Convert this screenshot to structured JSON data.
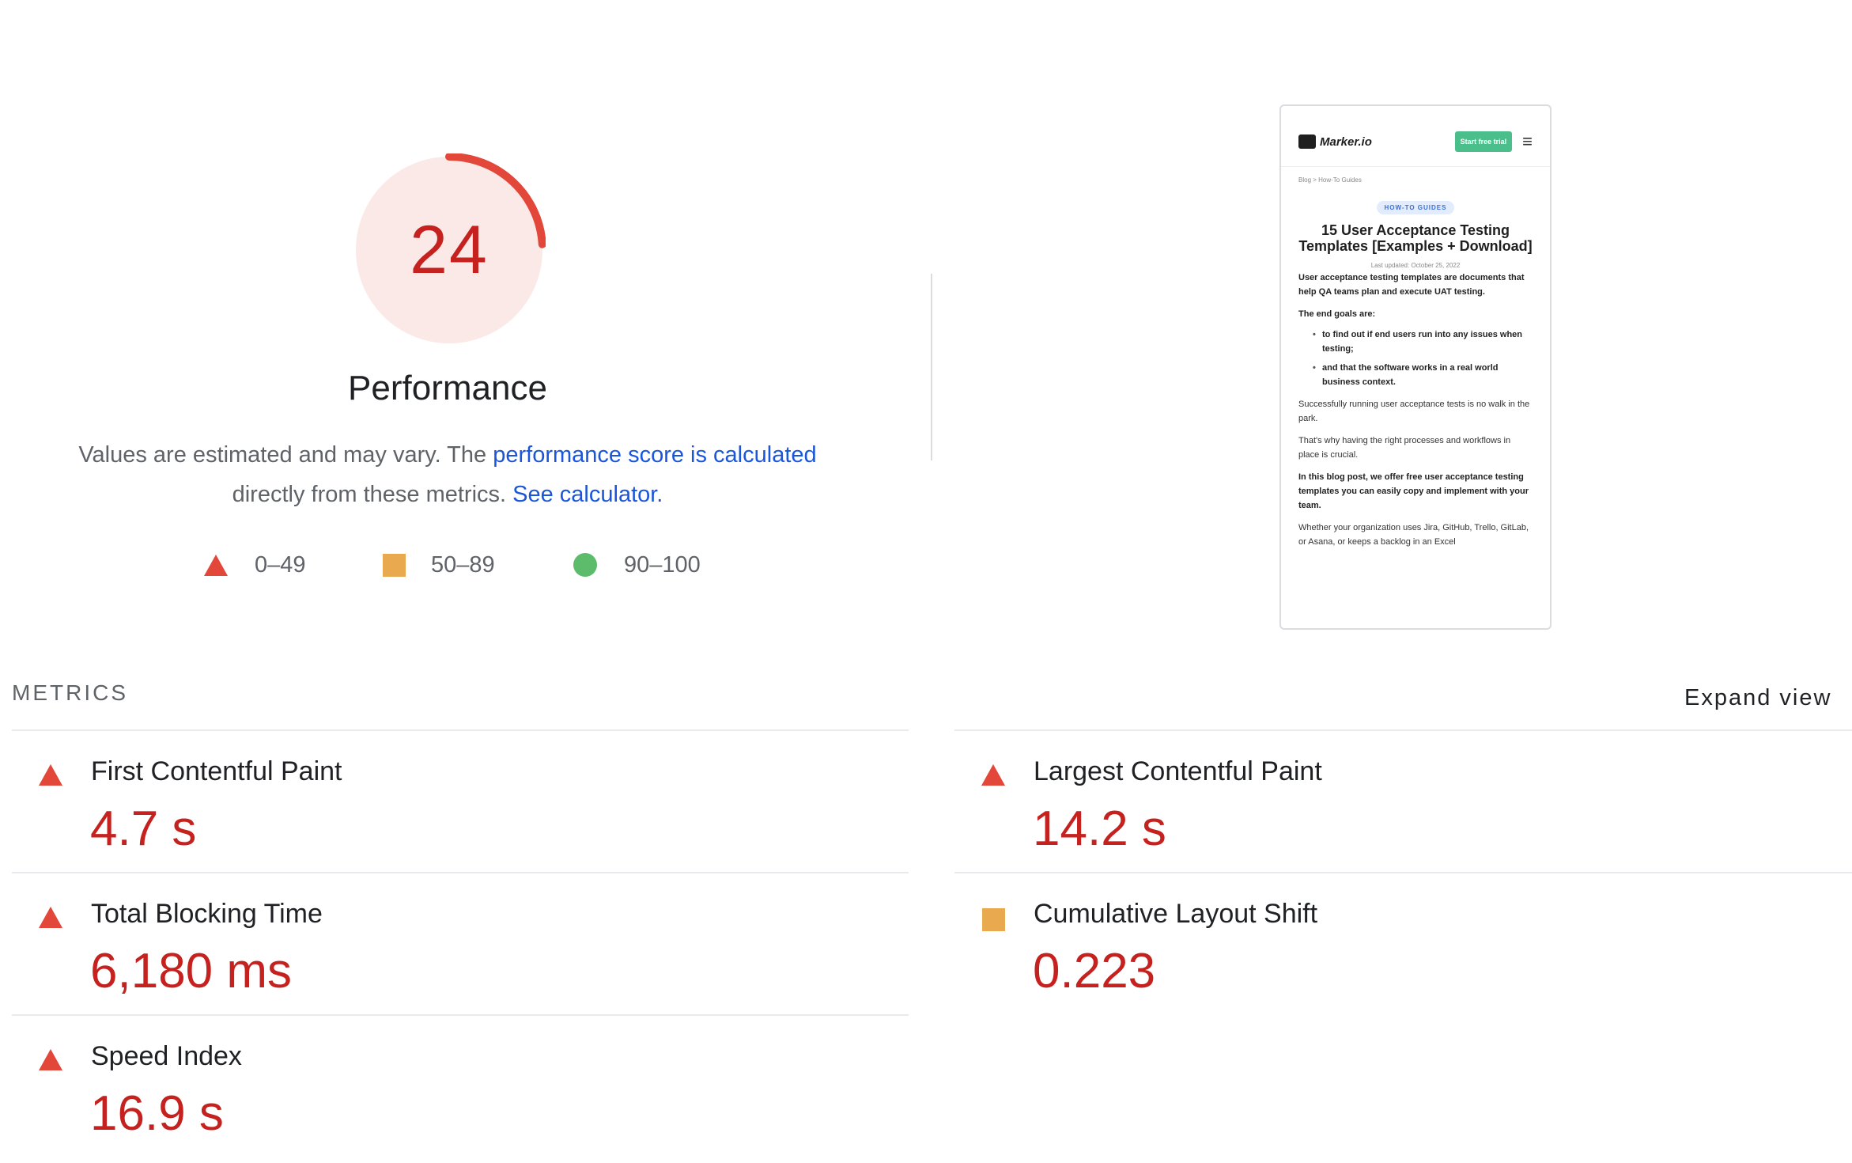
{
  "score": {
    "value": "24",
    "fraction": 0.24,
    "title": "Performance",
    "color": "#c5221f"
  },
  "description": {
    "text1": "Values are estimated and may vary. The ",
    "link1": "performance score is calculated",
    "text2": "directly from these metrics. ",
    "link2": "See calculator."
  },
  "legend": [
    {
      "range": "0–49",
      "icon": "triangle-icon",
      "color": "#e2473a"
    },
    {
      "range": "50–89",
      "icon": "square-icon",
      "color": "#e8a94f"
    },
    {
      "range": "90–100",
      "icon": "circle-icon",
      "color": "#5dbc6b"
    }
  ],
  "screenshot": {
    "logo": "Marker.io",
    "trial_button": "Start free trial",
    "breadcrumb": "Blog  >  How-To Guides",
    "badge": "HOW-TO GUIDES",
    "title": "15 User Acceptance Testing Templates [Examples + Download]",
    "date": "Last updated:  October 25, 2022",
    "intro": "User acceptance testing templates are documents that help QA teams plan and execute UAT testing.",
    "goals_head": "The end goals are:",
    "goal1": "to find out if end users run into any issues when testing;",
    "goal2": "and that the software works in a real world business context.",
    "p1": "Successfully running user acceptance tests is no walk in the park.",
    "p2": "That's why having the right processes and workflows in place is crucial.",
    "p3": "In this blog post, we offer free user acceptance testing templates you can easily copy and implement with your team.",
    "p4": "Whether your organization uses Jira, GitHub, Trello, GitLab, or Asana, or keeps a backlog in an Excel"
  },
  "metrics_header": "METRICS",
  "expand_view": "Expand view",
  "metrics": [
    {
      "label": "First Contentful Paint",
      "value": "4.7 s",
      "status": "fail"
    },
    {
      "label": "Largest Contentful Paint",
      "value": "14.2 s",
      "status": "fail"
    },
    {
      "label": "Total Blocking Time",
      "value": "6,180 ms",
      "status": "fail"
    },
    {
      "label": "Cumulative Layout Shift",
      "value": "0.223",
      "status": "average"
    },
    {
      "label": "Speed Index",
      "value": "16.9 s",
      "status": "fail"
    }
  ]
}
